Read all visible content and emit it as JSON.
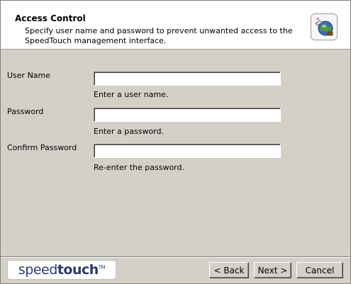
{
  "header": {
    "title": "Access Control",
    "description": "Specify user name and password to prevent unwanted access to the SpeedTouch management interface.",
    "icon": "wizard-globe-icon"
  },
  "form": {
    "username": {
      "label": "User Name",
      "value": "",
      "hint": "Enter a user name."
    },
    "password": {
      "label": "Password",
      "value": "",
      "hint": "Enter a password."
    },
    "confirm": {
      "label": "Confirm Password",
      "value": "",
      "hint": "Re-enter the password."
    }
  },
  "footer": {
    "logo_light": "speed",
    "logo_bold": "touch",
    "logo_tm": "TM",
    "back_label": "< Back",
    "next_label": "Next >",
    "cancel_label": "Cancel"
  },
  "colors": {
    "dialog_bg": "#d4d0c8",
    "header_bg": "#ffffff",
    "logo_color": "#2a3a6e"
  }
}
